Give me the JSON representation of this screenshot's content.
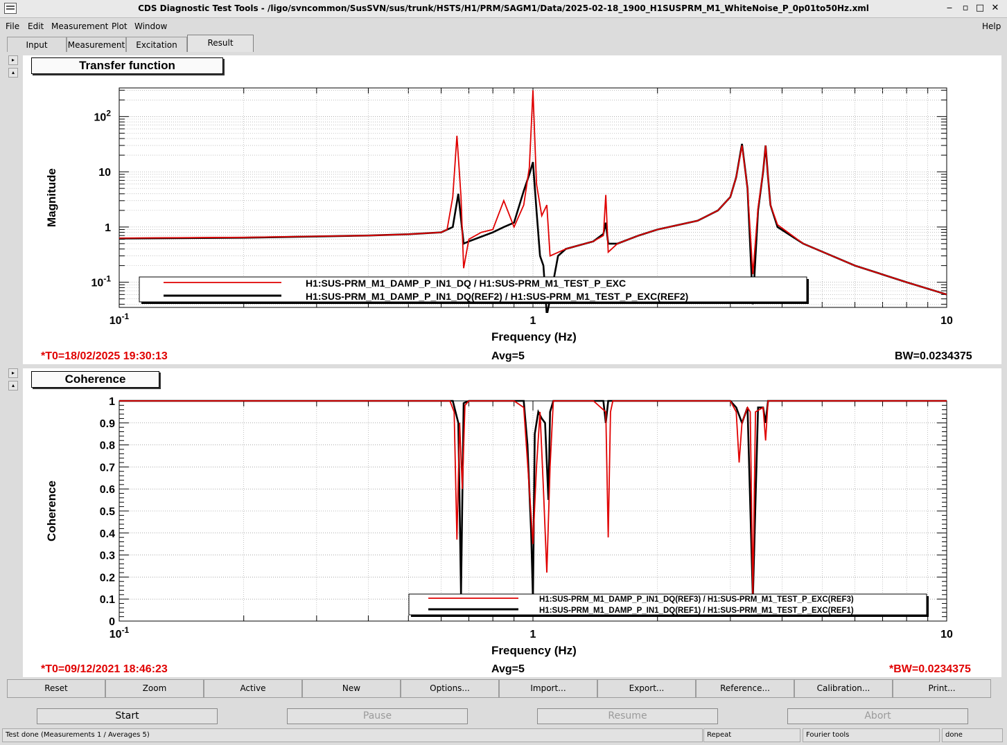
{
  "window": {
    "title": "CDS Diagnostic Test Tools - /ligo/svncommon/SusSVN/sus/trunk/HSTS/H1/PRM/SAGM1/Data/2025-02-18_1900_H1SUSPRM_M1_WhiteNoise_P_0p01to50Hz.xml",
    "minimize": "‒",
    "restore": "▫",
    "maximize": "□",
    "close": "✕"
  },
  "menu": {
    "file": "File",
    "edit": "Edit",
    "measurement": "Measurement",
    "plot": "Plot",
    "window": "Window",
    "help": "Help"
  },
  "tabs": [
    "Input",
    "Measurement",
    "Excitation",
    "Result"
  ],
  "side_arrows": {
    "right": "▸",
    "up": "▴"
  },
  "transfer_panel": {
    "title": "Transfer function",
    "t0": "*T0=18/02/2025 19:30:13",
    "avg": "Avg=5",
    "bw": "BW=0.0234375"
  },
  "coherence_panel": {
    "title": "Coherence",
    "t0": "*T0=09/12/2021 18:46:23",
    "avg": "Avg=5",
    "bw": "*BW=0.0234375"
  },
  "chart_data": [
    {
      "type": "line",
      "title": "Transfer function",
      "xlabel": "Frequency (Hz)",
      "ylabel": "Magnitude",
      "xscale": "log",
      "yscale": "log",
      "xlim": [
        0.1,
        10
      ],
      "ylim": [
        0.035,
        330
      ],
      "x_tick_labels": [
        "10^-1",
        "1",
        "10"
      ],
      "y_tick_labels": [
        "10^-1",
        "1",
        "10",
        "10^2"
      ],
      "grid": true,
      "legend": "bottom",
      "series": [
        {
          "name": "H1:SUS-PRM_M1_DAMP_P_IN1_DQ / H1:SUS-PRM_M1_TEST_P_EXC",
          "color": "#e00000",
          "x": [
            0.1,
            0.2,
            0.4,
            0.5,
            0.6,
            0.62,
            0.64,
            0.655,
            0.67,
            0.68,
            0.7,
            0.75,
            0.8,
            0.85,
            0.9,
            0.95,
            0.98,
            1.0,
            1.02,
            1.05,
            1.08,
            1.1,
            1.2,
            1.4,
            1.48,
            1.5,
            1.52,
            1.6,
            1.8,
            2.0,
            2.5,
            2.8,
            3.0,
            3.1,
            3.2,
            3.3,
            3.4,
            3.5,
            3.6,
            3.65,
            3.7,
            3.75,
            3.9,
            4.5,
            6.0,
            8.0,
            10.0
          ],
          "y": [
            0.63,
            0.65,
            0.7,
            0.74,
            0.8,
            0.9,
            3.5,
            45,
            3.5,
            0.18,
            0.6,
            0.8,
            0.9,
            3.0,
            1.0,
            2.5,
            12,
            300,
            6,
            1.6,
            2.5,
            0.3,
            0.4,
            0.55,
            0.7,
            3.8,
            0.35,
            0.5,
            0.7,
            0.9,
            1.3,
            2.0,
            3.5,
            8.0,
            30,
            5.0,
            0.14,
            2.2,
            10,
            30,
            8,
            2.5,
            1.1,
            0.5,
            0.2,
            0.1,
            0.06
          ]
        },
        {
          "name": "H1:SUS-PRM_M1_DAMP_P_IN1_DQ(REF2) / H1:SUS-PRM_M1_TEST_P_EXC(REF2)",
          "color": "#000000",
          "x": [
            0.1,
            0.2,
            0.4,
            0.5,
            0.6,
            0.64,
            0.66,
            0.68,
            0.7,
            0.8,
            0.85,
            0.9,
            0.95,
            0.98,
            1.0,
            1.02,
            1.04,
            1.06,
            1.08,
            1.1,
            1.15,
            1.2,
            1.4,
            1.48,
            1.5,
            1.52,
            1.6,
            1.8,
            2.0,
            2.5,
            2.8,
            3.0,
            3.1,
            3.2,
            3.3,
            3.4,
            3.5,
            3.6,
            3.65,
            3.7,
            3.75,
            3.9,
            4.5,
            6.0,
            8.0,
            10.0
          ],
          "y": [
            0.62,
            0.64,
            0.7,
            0.74,
            0.8,
            1.0,
            4.0,
            0.5,
            0.55,
            0.8,
            1.0,
            1.2,
            4.5,
            9,
            15,
            2.0,
            0.3,
            0.2,
            0.025,
            0.05,
            0.3,
            0.4,
            0.55,
            0.75,
            1.2,
            0.5,
            0.5,
            0.7,
            0.9,
            1.3,
            2.0,
            3.5,
            8.0,
            32,
            5.0,
            0.04,
            2.0,
            10,
            30,
            8,
            2.5,
            1.0,
            0.5,
            0.2,
            0.1,
            0.06
          ]
        }
      ]
    },
    {
      "type": "line",
      "title": "Coherence",
      "xlabel": "Frequency (Hz)",
      "ylabel": "Coherence",
      "xscale": "log",
      "xlim": [
        0.1,
        10
      ],
      "ylim": [
        0,
        1
      ],
      "x_tick_labels": [
        "10^-1",
        "1",
        "10"
      ],
      "y_tick_labels": [
        "0",
        "0.1",
        "0.2",
        "0.3",
        "0.4",
        "0.5",
        "0.6",
        "0.7",
        "0.8",
        "0.9",
        "1"
      ],
      "grid": true,
      "legend": "bottom-right",
      "series": [
        {
          "name": "H1:SUS-PRM_M1_DAMP_P_IN1_DQ(REF3) / H1:SUS-PRM_M1_TEST_P_EXC(REF3)",
          "color": "#e00000",
          "x": [
            0.1,
            0.63,
            0.645,
            0.655,
            0.665,
            0.675,
            0.685,
            0.7,
            0.9,
            0.95,
            0.98,
            1.0,
            1.02,
            1.04,
            1.06,
            1.08,
            1.1,
            1.12,
            1.4,
            1.5,
            1.52,
            1.54,
            1.56,
            3.0,
            3.1,
            3.15,
            3.2,
            3.3,
            3.35,
            3.4,
            3.45,
            3.6,
            3.65,
            3.7,
            7.0,
            10.0
          ],
          "y": [
            1.0,
            1.0,
            0.95,
            0.37,
            0.9,
            0.6,
            0.98,
            1.0,
            1.0,
            0.97,
            0.6,
            0.35,
            0.7,
            0.95,
            0.6,
            0.22,
            0.7,
            1.0,
            1.0,
            0.95,
            0.38,
            0.95,
            1.0,
            1.0,
            0.95,
            0.72,
            0.9,
            0.97,
            0.95,
            0.12,
            0.95,
            0.97,
            0.82,
            1.0,
            1.0,
            1.0
          ]
        },
        {
          "name": "H1:SUS-PRM_M1_DAMP_P_IN1_DQ(REF1) / H1:SUS-PRM_M1_TEST_P_EXC(REF1)",
          "color": "#000000",
          "x": [
            0.1,
            0.64,
            0.66,
            0.67,
            0.68,
            0.7,
            0.95,
            0.97,
            0.99,
            1.0,
            1.01,
            1.03,
            1.05,
            1.07,
            1.09,
            1.1,
            1.12,
            1.48,
            1.5,
            1.52,
            3.0,
            3.1,
            3.2,
            3.3,
            3.4,
            3.5,
            3.6,
            3.65,
            3.7,
            10.0
          ],
          "y": [
            1.0,
            1.0,
            0.9,
            0.12,
            0.99,
            1.0,
            1.0,
            0.8,
            0.4,
            0.1,
            0.85,
            0.95,
            0.92,
            0.9,
            0.55,
            0.95,
            1.0,
            1.0,
            0.9,
            1.0,
            1.0,
            0.97,
            0.9,
            0.97,
            0.1,
            0.97,
            0.97,
            0.9,
            1.0,
            1.0
          ]
        }
      ]
    }
  ],
  "toolbar": [
    "Reset",
    "Zoom",
    "Active",
    "New",
    "Options...",
    "Import...",
    "Export...",
    "Reference...",
    "Calibration...",
    "Print..."
  ],
  "controls": {
    "start": "Start",
    "pause": "Pause",
    "resume": "Resume",
    "abort": "Abort"
  },
  "status": {
    "message": "Test done (Measurements 1 / Averages 5)",
    "mode": "Repeat",
    "tool": "Fourier tools",
    "state": "done"
  }
}
